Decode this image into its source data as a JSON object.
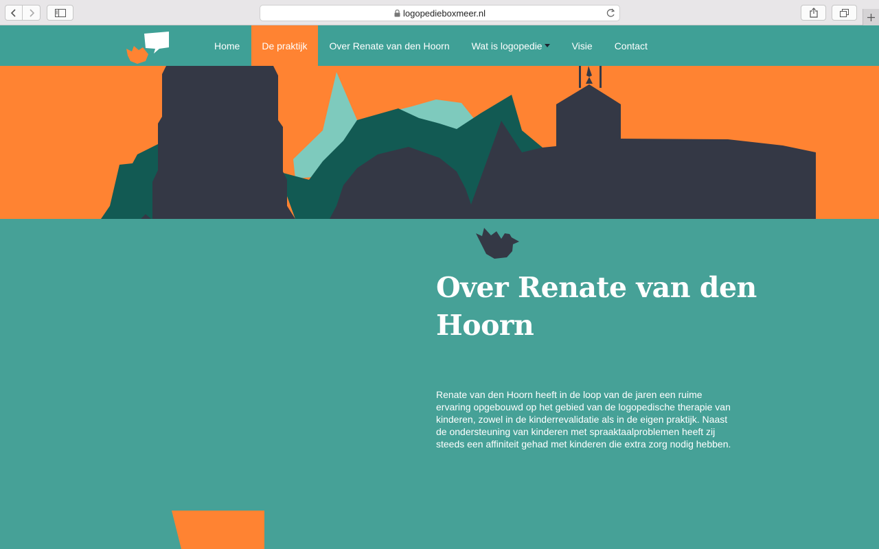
{
  "browser": {
    "url": "logopedieboxmeer.nl",
    "icons": [
      "back-icon",
      "forward-icon",
      "sidebar-icon",
      "lock-icon",
      "reload-icon",
      "share-icon",
      "tabs-icon",
      "plus-icon"
    ]
  },
  "nav": {
    "items": [
      {
        "label": "Home",
        "active": false
      },
      {
        "label": "De praktijk",
        "active": true
      },
      {
        "label": "Over Renate van den Hoorn",
        "active": false
      },
      {
        "label": "Wat is logopedie",
        "active": false,
        "has_dropdown": true
      },
      {
        "label": "Visie",
        "active": false
      },
      {
        "label": "Contact",
        "active": false
      }
    ]
  },
  "main": {
    "heading": "Over Renate van den Hoorn",
    "paragraph": "Renate van den Hoorn heeft in de loop van de jaren een ruime ervaring opgebouwd op het gebied van de logopedische therapie van kinderen, zowel in de kinderrevalidatie als in de eigen praktijk. Naast de ondersteuning van kinderen met spraaktaalproblemen heeft zij steeds een affiniteit gehad met kinderen die extra zorg nodig hebben."
  },
  "colors": {
    "teal_nav": "#3fa096",
    "teal_body": "#46a197",
    "orange": "#ff8332",
    "dark": "#343845",
    "dark_green": "#125a53",
    "light_teal": "#7ecabd"
  }
}
